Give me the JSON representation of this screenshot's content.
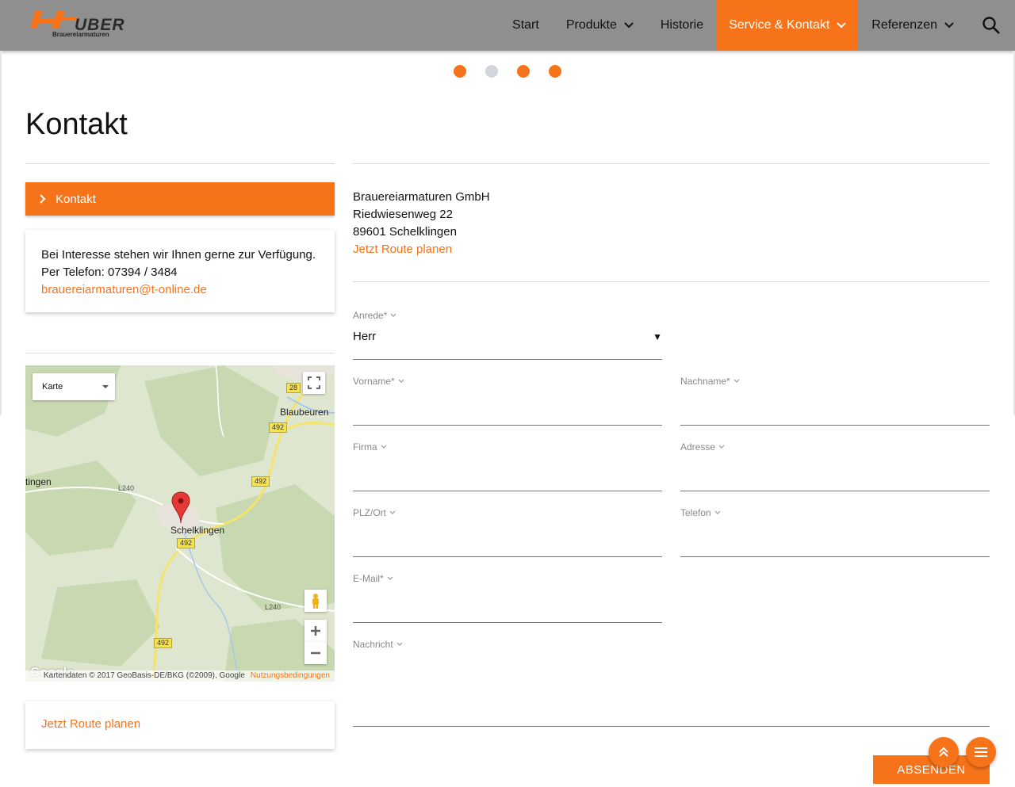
{
  "header": {
    "logo_text": "UBER",
    "logo_sub": "Brauereiarmaturen",
    "nav": [
      {
        "label": "Start"
      },
      {
        "label": "Produkte"
      },
      {
        "label": "Historie"
      },
      {
        "label": "Service & Kontakt",
        "active": true
      },
      {
        "label": "Referenzen"
      }
    ]
  },
  "carousel": {
    "dots": 4,
    "active_index": 1
  },
  "page": {
    "title": "Kontakt"
  },
  "sidebar": {
    "kontakt_label": "Kontakt",
    "info_line1": "Bei Interesse stehen wir Ihnen gerne zur Verfügung.",
    "info_line2": "Per Telefon: 07394 / 3484",
    "email": "brauereiarmaturen@t-online.de",
    "route_label": "Jetzt Route planen"
  },
  "map": {
    "type_select": "Karte",
    "labels": {
      "blaubeuren": "Blaubeuren",
      "schelklingen": "Schelklingen",
      "tingen": "tingen",
      "l240a": "L240",
      "l240b": "L240"
    },
    "roads": {
      "r28": "28",
      "r492a": "492",
      "r492b": "492",
      "r492c": "492",
      "r492d": "492"
    },
    "attribution": "Kartendaten © 2017 GeoBasis-DE/BKG (©2009), Google",
    "terms": "Nutzungsbedingungen",
    "google": "Google"
  },
  "address": {
    "company": "Brauereiarmaturen GmbH",
    "street": "Riedwiesenweg 22",
    "city": "89601 Schelklingen",
    "route_link": "Jetzt Route planen"
  },
  "form": {
    "anrede_label": "Anrede*",
    "anrede_value": "Herr",
    "vorname_label": "Vorname*",
    "nachname_label": "Nachname*",
    "firma_label": "Firma",
    "adresse_label": "Adresse",
    "plzort_label": "PLZ/Ort",
    "telefon_label": "Telefon",
    "email_label": "E-Mail*",
    "nachricht_label": "Nachricht",
    "submit_label": "ABSENDEN"
  },
  "colors": {
    "accent": "#f7731a",
    "nav_bg": "#8f8f8f"
  }
}
